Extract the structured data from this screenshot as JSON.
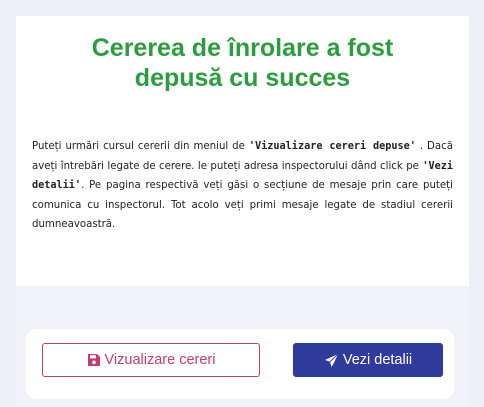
{
  "title": "Cererea de înrolare a fost\ndepusă cu succes",
  "description": {
    "p1": "Puteți urmări cursul cererii din meniul de ",
    "link1": "'Vizualizare cereri depuse'",
    "p2": " . Dacă aveți întrebări legate de cerere. le puteți adresa inspectorului dând click pe ",
    "link2": "'Vezi detalii'",
    "p3": ". Pe pagina respectivă veți găsi o secțiune de mesaje prin care puteți comunica cu inspectorul. Tot acolo veți primi mesaje legate de stadiul cererii dumneavoastră."
  },
  "actions": {
    "view_requests_label": "Vizualizare cereri",
    "view_requests_icon": "save-icon",
    "view_details_label": "Vezi detalii",
    "view_details_icon": "paper-plane-icon"
  },
  "colors": {
    "title": "#2a9d3d",
    "outline_button": "#c33d6e",
    "primary_button": "#2e3a9c"
  }
}
